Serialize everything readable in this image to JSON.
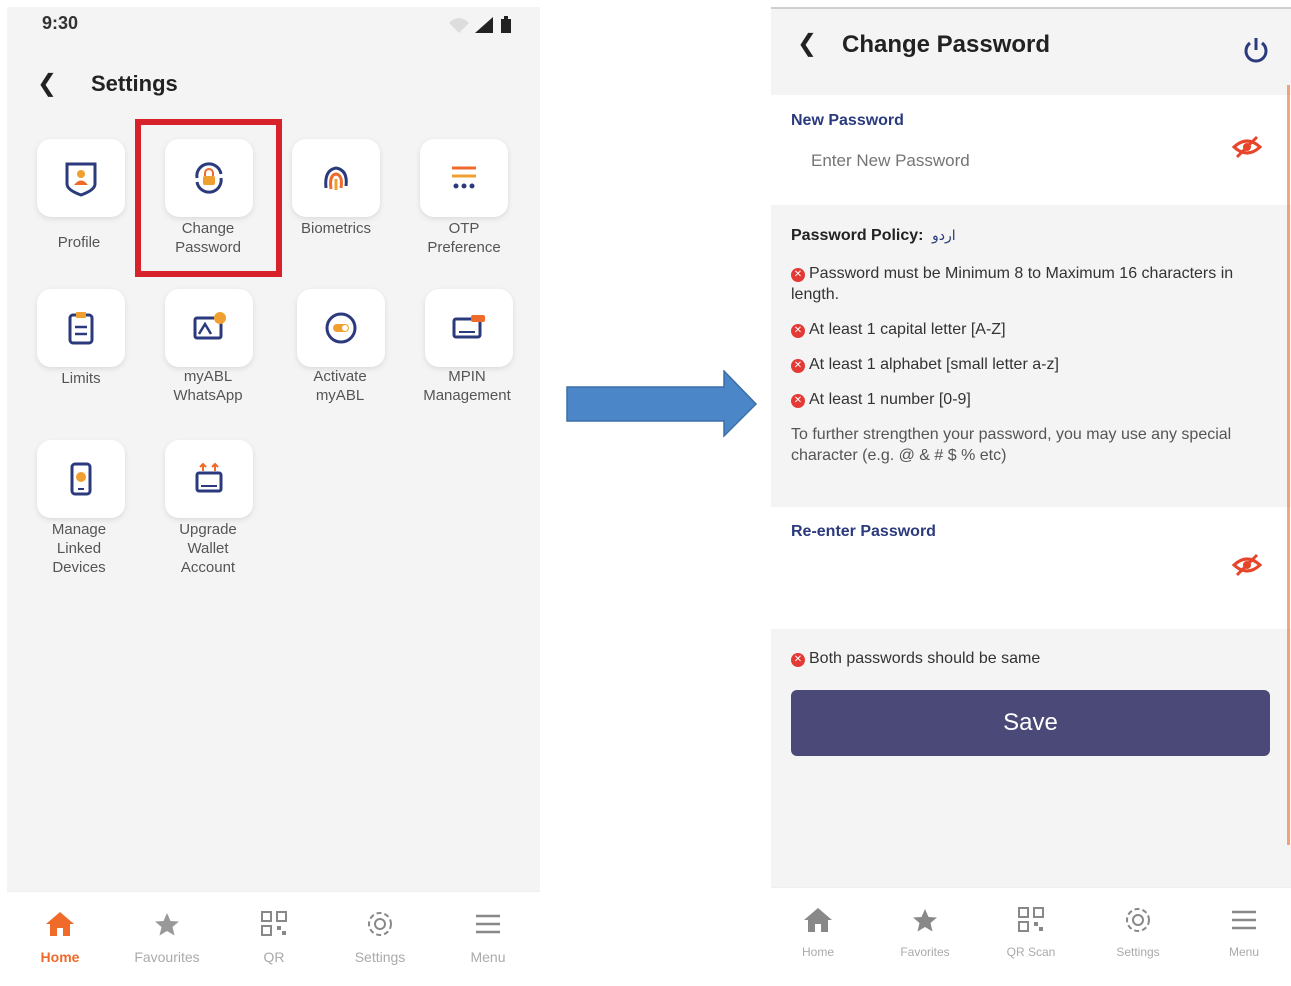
{
  "left": {
    "status_time": "9:30",
    "title": "Settings",
    "tiles": [
      {
        "label": "Profile",
        "icon": "profile-icon"
      },
      {
        "label": "Change\nPassword",
        "icon": "change-password-icon"
      },
      {
        "label": "Biometrics",
        "icon": "fingerprint-icon"
      },
      {
        "label": "OTP\nPreference",
        "icon": "otp-preference-icon"
      },
      {
        "label": "Limits",
        "icon": "clipboard-icon"
      },
      {
        "label": "myABL\nWhatsApp",
        "icon": "whatsapp-icon"
      },
      {
        "label": "Activate\nmyABL",
        "icon": "toggle-icon"
      },
      {
        "label": "MPIN\nManagement",
        "icon": "mpin-icon"
      },
      {
        "label": "Manage\nLinked\nDevices",
        "icon": "linked-devices-icon"
      },
      {
        "label": "Upgrade\nWallet\nAccount",
        "icon": "upgrade-wallet-icon"
      }
    ],
    "nav": [
      {
        "label": "Home",
        "icon": "home-icon",
        "active": true
      },
      {
        "label": "Favourites",
        "icon": "star-icon",
        "active": false
      },
      {
        "label": "QR",
        "icon": "qr-icon",
        "active": false
      },
      {
        "label": "Settings",
        "icon": "gear-icon",
        "active": false
      },
      {
        "label": "Menu",
        "icon": "menu-icon",
        "active": false
      }
    ]
  },
  "right": {
    "title": "Change Password",
    "new_password_label": "New Password",
    "new_password_placeholder": "Enter New Password",
    "policy_title": "Password Policy:",
    "policy_urdu": "اردو",
    "rules": [
      "Password must be Minimum 8 to Maximum 16 characters in length.",
      "At least 1 capital letter [A-Z]",
      "At least 1 alphabet [small letter a-z]",
      "At least 1 number [0-9]"
    ],
    "policy_note": "To further strengthen your password, you may use any special character (e.g. @ & # $ % etc)",
    "reenter_label": "Re-enter Password",
    "match_message": "Both passwords should be same",
    "save_label": "Save",
    "nav": [
      {
        "label": "Home",
        "icon": "home-icon"
      },
      {
        "label": "Favorites",
        "icon": "star-icon"
      },
      {
        "label": "QR Scan",
        "icon": "qr-icon"
      },
      {
        "label": "Settings",
        "icon": "gear-icon"
      },
      {
        "label": "Menu",
        "icon": "menu-icon"
      }
    ]
  },
  "colors": {
    "accent": "#f06a2a",
    "highlight": "#d7222c",
    "navy": "#2b3a7c",
    "save_button": "#4b4977",
    "arrow": "#4a86c8",
    "error": "#e53935"
  }
}
